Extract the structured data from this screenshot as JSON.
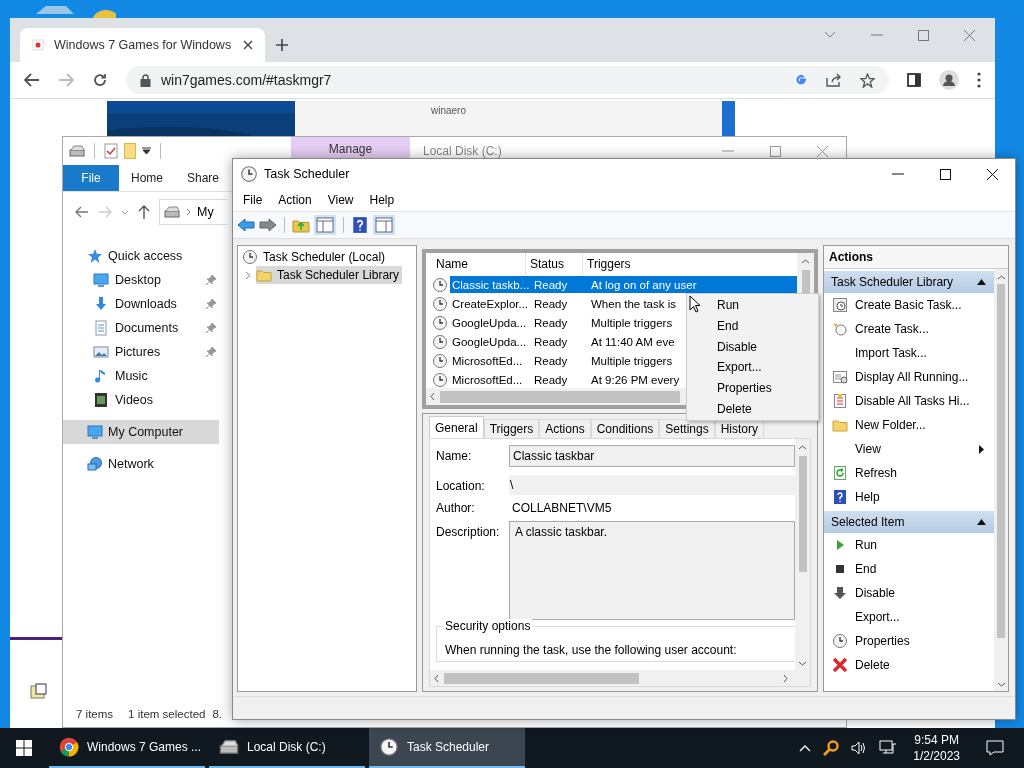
{
  "browser": {
    "tab_title": "Windows 7 Games for Windows",
    "url": "win7games.com/#taskmgr7",
    "page_label": "winaero"
  },
  "explorer": {
    "context_tab": "Manage",
    "title": "Local Disk (C:)",
    "ribbon_tabs": [
      {
        "label": "File",
        "selected": true
      },
      {
        "label": "Home",
        "selected": false
      },
      {
        "label": "Share",
        "selected": false
      }
    ],
    "address": "My",
    "nav": [
      {
        "label": "Quick access",
        "kind": "star",
        "selected": false,
        "children": [
          {
            "label": "Desktop",
            "kind": "desktop",
            "pinned": true,
            "selected": false
          },
          {
            "label": "Downloads",
            "kind": "download",
            "pinned": true,
            "selected": false
          },
          {
            "label": "Documents",
            "kind": "document",
            "pinned": true,
            "selected": false
          },
          {
            "label": "Pictures",
            "kind": "picture",
            "pinned": true,
            "selected": false
          },
          {
            "label": "Music",
            "kind": "music",
            "pinned": false,
            "selected": false
          },
          {
            "label": "Videos",
            "kind": "video",
            "pinned": false,
            "selected": false
          }
        ]
      },
      {
        "label": "My Computer",
        "kind": "computer",
        "selected": true
      },
      {
        "label": "Network",
        "kind": "network",
        "selected": false
      }
    ],
    "status": [
      "7 items",
      "1 item selected",
      "8."
    ]
  },
  "task_scheduler": {
    "title": "Task Scheduler",
    "menu": [
      "File",
      "Action",
      "View",
      "Help"
    ],
    "tree": [
      {
        "label": "Task Scheduler (Local)",
        "kind": "clock",
        "selected": false,
        "children": [
          {
            "label": "Task Scheduler Library",
            "kind": "folder",
            "selected": true,
            "expanded": false
          }
        ]
      }
    ],
    "table": {
      "columns": [
        "Name",
        "Status",
        "Triggers"
      ],
      "rows": [
        {
          "name": "Classic taskb...",
          "status": "Ready",
          "triggers": "At log on of any user",
          "selected": true
        },
        {
          "name": "CreateExplor...",
          "status": "Ready",
          "triggers": "When the task is",
          "selected": false
        },
        {
          "name": "GoogleUpda...",
          "status": "Ready",
          "triggers": "Multiple triggers",
          "selected": false
        },
        {
          "name": "GoogleUpda...",
          "status": "Ready",
          "triggers": "At 11:40 AM eve",
          "selected": false
        },
        {
          "name": "MicrosoftEd...",
          "status": "Ready",
          "triggers": "Multiple triggers",
          "selected": false
        },
        {
          "name": "MicrosoftEd...",
          "status": "Ready",
          "triggers": "At 9:26 PM every",
          "selected": false
        }
      ]
    },
    "detail_tabs": [
      {
        "label": "General",
        "selected": true
      },
      {
        "label": "Triggers",
        "selected": false
      },
      {
        "label": "Actions",
        "selected": false
      },
      {
        "label": "Conditions",
        "selected": false
      },
      {
        "label": "Settings",
        "selected": false
      },
      {
        "label": "History",
        "selected": false
      }
    ],
    "fields": [
      {
        "label": "Name:",
        "value": "Classic taskbar",
        "kind": "box"
      },
      {
        "label": "Location:",
        "value": "\\",
        "kind": "shaded"
      },
      {
        "label": "Author:",
        "value": "COLLABNET\\VM5",
        "kind": "plain"
      },
      {
        "label": "Description:",
        "value": "A classic taskbar.",
        "kind": "area"
      }
    ],
    "security_title": "Security options",
    "security_text": "When running the task, use the following user account:",
    "actions": {
      "title": "Actions",
      "sections": [
        {
          "title": "Task Scheduler Library",
          "expanded": true,
          "items": [
            {
              "label": "Create Basic Task...",
              "kind": "task"
            },
            {
              "label": "Create Task...",
              "kind": "newtask"
            },
            {
              "label": "Import Task...",
              "kind": "plain"
            },
            {
              "label": "Display All Running...",
              "kind": "list"
            },
            {
              "label": "Disable All Tasks Hi...",
              "kind": "log"
            },
            {
              "label": "New Folder...",
              "kind": "folder"
            },
            {
              "label": "View",
              "kind": "plain",
              "submenu": true
            },
            {
              "label": "Refresh",
              "kind": "refresh"
            },
            {
              "label": "Help",
              "kind": "help"
            }
          ]
        },
        {
          "title": "Selected Item",
          "expanded": true,
          "items": [
            {
              "label": "Run",
              "kind": "run"
            },
            {
              "label": "End",
              "kind": "end"
            },
            {
              "label": "Disable",
              "kind": "disable"
            },
            {
              "label": "Export...",
              "kind": "plain"
            },
            {
              "label": "Properties",
              "kind": "clock"
            },
            {
              "label": "Delete",
              "kind": "delete"
            }
          ]
        }
      ]
    }
  },
  "context_menu": [
    "Run",
    "End",
    "Disable",
    "Export...",
    "Properties",
    "Delete"
  ],
  "taskbar": {
    "apps": [
      {
        "label": "Windows 7 Games ...",
        "kind": "chrome",
        "selected": false
      },
      {
        "label": "Local Disk (C:)",
        "kind": "drive",
        "selected": false
      },
      {
        "label": "Task Scheduler",
        "kind": "clock",
        "selected": true
      }
    ],
    "time": "9:54 PM",
    "date": "1/2/2023"
  }
}
